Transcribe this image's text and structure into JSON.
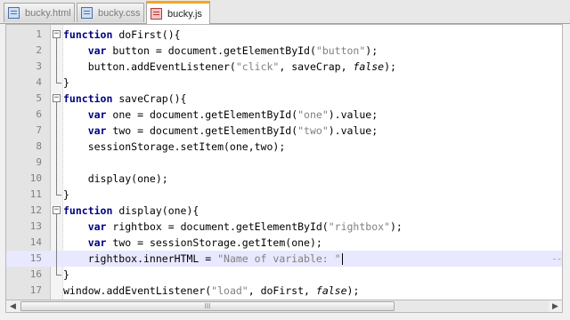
{
  "tabs": [
    {
      "label": "bucky.html",
      "active": false
    },
    {
      "label": "bucky.css",
      "active": false
    },
    {
      "label": "bucky.js",
      "active": true
    }
  ],
  "editor": {
    "lines": [
      {
        "n": "1",
        "t": "function doFirst(){"
      },
      {
        "n": "2",
        "t": "    var button = document.getElementById(\"button\");"
      },
      {
        "n": "3",
        "t": "    button.addEventListener(\"click\", saveCrap, false);"
      },
      {
        "n": "4",
        "t": "}"
      },
      {
        "n": "5",
        "t": "function saveCrap(){"
      },
      {
        "n": "6",
        "t": "    var one = document.getElementById(\"one\").value;"
      },
      {
        "n": "7",
        "t": "    var two = document.getElementById(\"two\").value;"
      },
      {
        "n": "8",
        "t": "    sessionStorage.setItem(one,two);"
      },
      {
        "n": "9",
        "t": ""
      },
      {
        "n": "10",
        "t": "    display(one);"
      },
      {
        "n": "11",
        "t": "}"
      },
      {
        "n": "12",
        "t": "function display(one){"
      },
      {
        "n": "13",
        "t": "    var rightbox = document.getElementById(\"rightbox\");"
      },
      {
        "n": "14",
        "t": "    var two = sessionStorage.getItem(one);"
      },
      {
        "n": "15",
        "t": "    rightbox.innerHTML = \"Name of variable: \""
      },
      {
        "n": "16",
        "t": "}"
      },
      {
        "n": "17",
        "t": "window.addEventListener(\"load\", doFirst, false);"
      }
    ],
    "current_line": 15
  },
  "scrollbar": {
    "thumb_grip": "III",
    "left_arrow": "◀",
    "right_arrow": "▶"
  }
}
